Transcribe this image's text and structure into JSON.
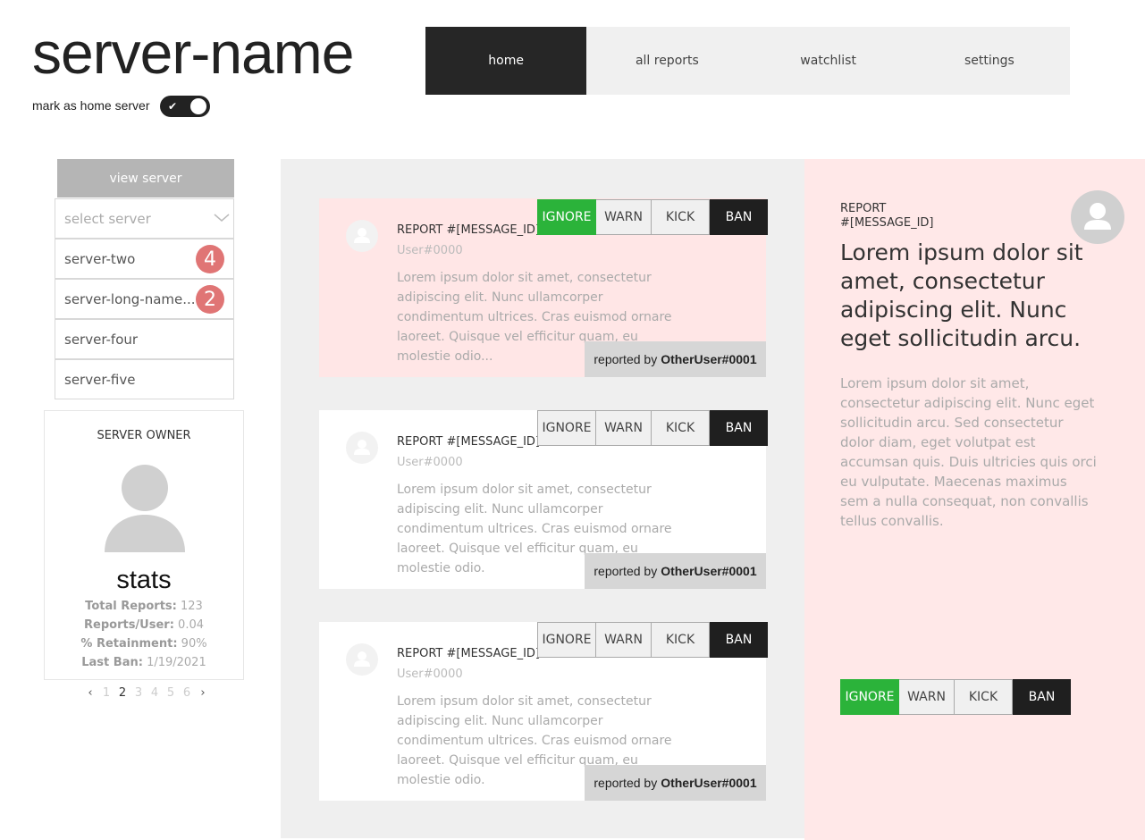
{
  "header": {
    "server_name": "server-name",
    "home_label": "mark as home server",
    "home_toggle_on": true
  },
  "nav": {
    "tabs": [
      {
        "label": "home",
        "active": true
      },
      {
        "label": "all reports",
        "active": false
      },
      {
        "label": "watchlist",
        "active": false
      },
      {
        "label": "settings",
        "active": false
      }
    ]
  },
  "sidebar": {
    "view_server_label": "view server",
    "select_placeholder": "select server",
    "servers": [
      {
        "name": "server-two",
        "badge": "4"
      },
      {
        "name": "server-long-name...",
        "badge": "2"
      },
      {
        "name": "server-four",
        "badge": ""
      },
      {
        "name": "server-five",
        "badge": ""
      }
    ]
  },
  "owner": {
    "title": "SERVER OWNER",
    "stats_title": "stats",
    "stats": [
      {
        "label": "Total Reports:",
        "value": "123"
      },
      {
        "label": "Reports/User:",
        "value": "0.04"
      },
      {
        "label": "% Retainment:",
        "value": "90%"
      },
      {
        "label": "Last Ban:",
        "value": "1/19/2021"
      }
    ]
  },
  "pagination": {
    "pages": [
      "1",
      "2",
      "3",
      "4",
      "5",
      "6"
    ],
    "current": "2",
    "prev_icon": "chevron-left-icon",
    "next_icon": "chevron-right-icon"
  },
  "actions": {
    "ignore": "IGNORE",
    "warn": "WARN",
    "kick": "KICK",
    "ban": "BAN"
  },
  "reports": [
    {
      "title": "REPORT #[MESSAGE_ID]",
      "user": "User#0000",
      "body": "Lorem ipsum dolor sit amet, consectetur adipiscing elit. Nunc ullamcorper condimentum ultrices. Cras euismod ornare laoreet. Quisque vel efficitur quam, eu molestie odio...",
      "reported_by_label": "reported by",
      "reported_by_user": "OtherUser#0001",
      "selected": true
    },
    {
      "title": "REPORT #[MESSAGE_ID]",
      "user": "User#0000",
      "body": "Lorem ipsum dolor sit amet, consectetur adipiscing elit. Nunc ullamcorper condimentum ultrices. Cras euismod ornare laoreet. Quisque vel efficitur quam, eu molestie odio.",
      "reported_by_label": "reported by",
      "reported_by_user": "OtherUser#0001",
      "selected": false
    },
    {
      "title": "REPORT #[MESSAGE_ID]",
      "user": "User#0000",
      "body": "Lorem ipsum dolor sit amet, consectetur adipiscing elit. Nunc ullamcorper condimentum ultrices. Cras euismod ornare laoreet. Quisque vel efficitur quam, eu molestie odio.",
      "reported_by_label": "reported by",
      "reported_by_user": "OtherUser#0001",
      "selected": false
    }
  ],
  "detail": {
    "report_line1": "REPORT",
    "report_line2": "#[MESSAGE_ID]",
    "heading": "Lorem ipsum dolor sit amet, consectetur adipiscing elit. Nunc eget sollicitudin arcu.",
    "body": "Lorem ipsum dolor sit amet, consectetur adipiscing elit. Nunc eget sollicitudin arcu. Sed consectetur dolor diam, eget volutpat est accumsan quis. Duis ultricies quis orci eu vulputate. Maecenas maximus sem a nulla consequat, non convallis tellus convallis."
  },
  "colors": {
    "accent_dark": "#262626",
    "ignore_active": "#2bb33a",
    "badge": "#e07575",
    "detail_bg": "#ffe8e8",
    "highlight_card": "#ffe6e6"
  }
}
